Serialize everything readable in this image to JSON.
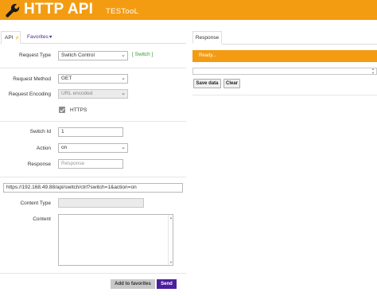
{
  "header": {
    "title": "HTTP API",
    "subtitle": "TESTooL",
    "icon": "wrench-icon",
    "color": "#f39c12"
  },
  "left_tabs": {
    "api_label": "API",
    "favorites_label": "Favorites"
  },
  "right_tabs": {
    "response_label": "Response"
  },
  "form": {
    "request_type_label": "Request Type",
    "request_type_value": "Switch Control",
    "switch_link": "[ Switch ]",
    "request_method_label": "Request Method",
    "request_method_value": "GET",
    "request_encoding_label": "Request Encoding",
    "request_encoding_value": "URL encoded",
    "https_label": "HTTPS",
    "https_checked": true,
    "switch_id_label": "Switch Id",
    "switch_id_value": "1",
    "action_label": "Action",
    "action_value": "on",
    "response_label": "Response",
    "response_placeholder": "Response",
    "url_value": "https://192.168.49.88/api/switch/ctrl?switch=1&action=on",
    "content_type_label": "Content Type",
    "content_type_value": "",
    "content_label": "Content",
    "content_value": ""
  },
  "buttons": {
    "add_favorites": "Add to favorites",
    "send": "Send"
  },
  "response_panel": {
    "status_text": "Ready...",
    "save_label": "Save data",
    "clear_label": "Clear"
  },
  "colors": {
    "accent": "#f39c12",
    "send": "#4a1e9e",
    "link_green": "#2e9a2e"
  }
}
